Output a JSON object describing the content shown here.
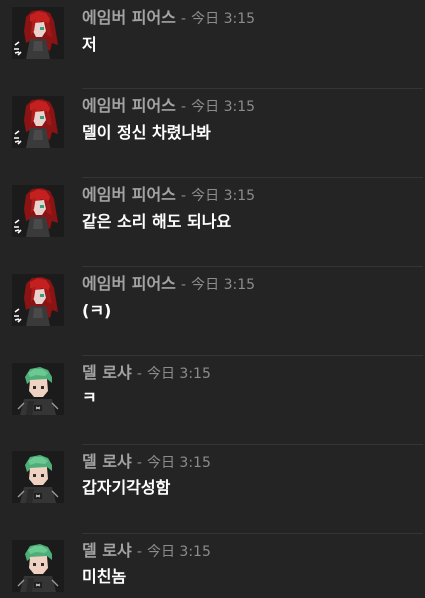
{
  "messages": [
    {
      "author": "에임버 피어스",
      "separator": "-",
      "time": "今日 3:15",
      "text": "저",
      "avatar": "red-haired-character-avatar"
    },
    {
      "author": "에임버 피어스",
      "separator": "-",
      "time": "今日 3:15",
      "text": "델이 정신 차렸나봐",
      "avatar": "red-haired-character-avatar"
    },
    {
      "author": "에임버 피어스",
      "separator": "-",
      "time": "今日 3:15",
      "text": "같은 소리 해도 되나요",
      "avatar": "red-haired-character-avatar"
    },
    {
      "author": "에임버 피어스",
      "separator": "-",
      "time": "今日 3:15",
      "text": "(ㅋ)",
      "avatar": "red-haired-character-avatar"
    },
    {
      "author": "델 로샤",
      "separator": "-",
      "time": "今日 3:15",
      "text": "ㅋ",
      "avatar": "green-haired-character-avatar"
    },
    {
      "author": "델 로샤",
      "separator": "-",
      "time": "今日 3:15",
      "text": "갑자기각성함",
      "avatar": "green-haired-character-avatar"
    },
    {
      "author": "델 로샤",
      "separator": "-",
      "time": "今日 3:15",
      "text": "미친놈",
      "avatar": "green-haired-character-avatar"
    }
  ],
  "colors": {
    "background": "#242424",
    "author": "#a3a3a3",
    "timestamp": "#8c8c8c",
    "message_text": "#ffffff",
    "divider": "#353535"
  }
}
